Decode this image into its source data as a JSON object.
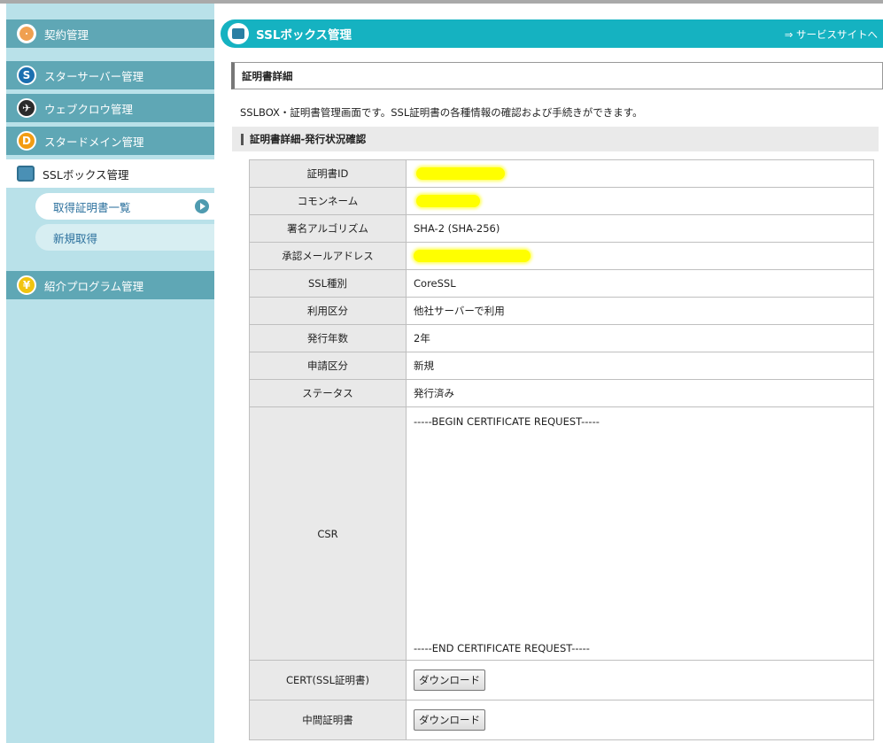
{
  "sidebar": {
    "items": [
      {
        "label": "契約管理"
      },
      {
        "label": "スターサーバー管理"
      },
      {
        "label": "ウェブクロウ管理"
      },
      {
        "label": "スタードメイン管理"
      },
      {
        "label": "SSLボックス管理"
      },
      {
        "label": "紹介プログラム管理"
      }
    ],
    "subitems": [
      {
        "label": "取得証明書一覧"
      },
      {
        "label": "新規取得"
      }
    ]
  },
  "header": {
    "title": "SSLボックス管理",
    "service_link": "⇒ サービスサイトへ"
  },
  "section_title": "証明書詳細",
  "description": "SSLBOX・証明書管理画面です。SSL証明書の各種情報の確認および手続きができます。",
  "subsection_title": "証明書詳細-発行状況確認",
  "details": [
    {
      "key": "証明書ID",
      "value": ""
    },
    {
      "key": "コモンネーム",
      "value": ""
    },
    {
      "key": "署名アルゴリズム",
      "value": "SHA-2 (SHA-256)"
    },
    {
      "key": "承認メールアドレス",
      "value": ""
    },
    {
      "key": "SSL種別",
      "value": "CoreSSL"
    },
    {
      "key": "利用区分",
      "value": "他社サーバーで利用"
    },
    {
      "key": "発行年数",
      "value": "2年"
    },
    {
      "key": "申請区分",
      "value": "新規"
    },
    {
      "key": "ステータス",
      "value": "発行済み"
    }
  ],
  "csr": {
    "label": "CSR",
    "begin": "-----BEGIN CERTIFICATE REQUEST-----",
    "end": "-----END CERTIFICATE REQUEST-----"
  },
  "downloads": [
    {
      "label": "CERT(SSL証明書)",
      "button": "ダウンロード"
    },
    {
      "label": "中間証明書",
      "button": "ダウンロード"
    }
  ],
  "colors": {
    "header_bg": "#15b2c1",
    "sidebar_bg": "#b9e1e9",
    "sidebar_item_bg": "#5fa7b5"
  }
}
